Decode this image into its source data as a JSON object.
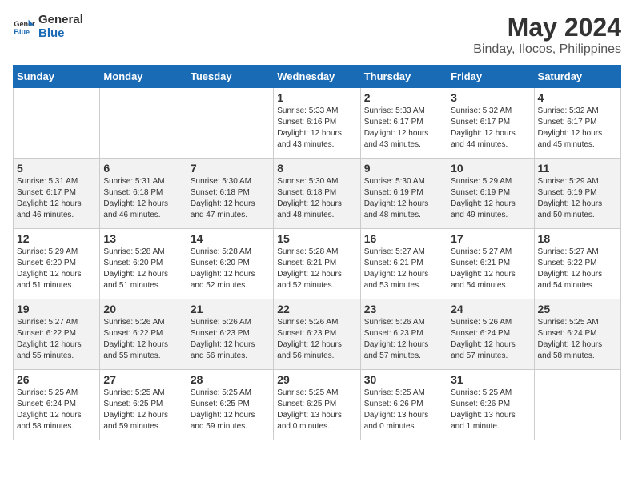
{
  "logo": {
    "line1": "General",
    "line2": "Blue"
  },
  "title": "May 2024",
  "subtitle": "Binday, Ilocos, Philippines",
  "days_of_week": [
    "Sunday",
    "Monday",
    "Tuesday",
    "Wednesday",
    "Thursday",
    "Friday",
    "Saturday"
  ],
  "weeks": [
    [
      {
        "day": "",
        "detail": ""
      },
      {
        "day": "",
        "detail": ""
      },
      {
        "day": "",
        "detail": ""
      },
      {
        "day": "1",
        "detail": "Sunrise: 5:33 AM\nSunset: 6:16 PM\nDaylight: 12 hours\nand 43 minutes."
      },
      {
        "day": "2",
        "detail": "Sunrise: 5:33 AM\nSunset: 6:17 PM\nDaylight: 12 hours\nand 43 minutes."
      },
      {
        "day": "3",
        "detail": "Sunrise: 5:32 AM\nSunset: 6:17 PM\nDaylight: 12 hours\nand 44 minutes."
      },
      {
        "day": "4",
        "detail": "Sunrise: 5:32 AM\nSunset: 6:17 PM\nDaylight: 12 hours\nand 45 minutes."
      }
    ],
    [
      {
        "day": "5",
        "detail": "Sunrise: 5:31 AM\nSunset: 6:17 PM\nDaylight: 12 hours\nand 46 minutes."
      },
      {
        "day": "6",
        "detail": "Sunrise: 5:31 AM\nSunset: 6:18 PM\nDaylight: 12 hours\nand 46 minutes."
      },
      {
        "day": "7",
        "detail": "Sunrise: 5:30 AM\nSunset: 6:18 PM\nDaylight: 12 hours\nand 47 minutes."
      },
      {
        "day": "8",
        "detail": "Sunrise: 5:30 AM\nSunset: 6:18 PM\nDaylight: 12 hours\nand 48 minutes."
      },
      {
        "day": "9",
        "detail": "Sunrise: 5:30 AM\nSunset: 6:19 PM\nDaylight: 12 hours\nand 48 minutes."
      },
      {
        "day": "10",
        "detail": "Sunrise: 5:29 AM\nSunset: 6:19 PM\nDaylight: 12 hours\nand 49 minutes."
      },
      {
        "day": "11",
        "detail": "Sunrise: 5:29 AM\nSunset: 6:19 PM\nDaylight: 12 hours\nand 50 minutes."
      }
    ],
    [
      {
        "day": "12",
        "detail": "Sunrise: 5:29 AM\nSunset: 6:20 PM\nDaylight: 12 hours\nand 51 minutes."
      },
      {
        "day": "13",
        "detail": "Sunrise: 5:28 AM\nSunset: 6:20 PM\nDaylight: 12 hours\nand 51 minutes."
      },
      {
        "day": "14",
        "detail": "Sunrise: 5:28 AM\nSunset: 6:20 PM\nDaylight: 12 hours\nand 52 minutes."
      },
      {
        "day": "15",
        "detail": "Sunrise: 5:28 AM\nSunset: 6:21 PM\nDaylight: 12 hours\nand 52 minutes."
      },
      {
        "day": "16",
        "detail": "Sunrise: 5:27 AM\nSunset: 6:21 PM\nDaylight: 12 hours\nand 53 minutes."
      },
      {
        "day": "17",
        "detail": "Sunrise: 5:27 AM\nSunset: 6:21 PM\nDaylight: 12 hours\nand 54 minutes."
      },
      {
        "day": "18",
        "detail": "Sunrise: 5:27 AM\nSunset: 6:22 PM\nDaylight: 12 hours\nand 54 minutes."
      }
    ],
    [
      {
        "day": "19",
        "detail": "Sunrise: 5:27 AM\nSunset: 6:22 PM\nDaylight: 12 hours\nand 55 minutes."
      },
      {
        "day": "20",
        "detail": "Sunrise: 5:26 AM\nSunset: 6:22 PM\nDaylight: 12 hours\nand 55 minutes."
      },
      {
        "day": "21",
        "detail": "Sunrise: 5:26 AM\nSunset: 6:23 PM\nDaylight: 12 hours\nand 56 minutes."
      },
      {
        "day": "22",
        "detail": "Sunrise: 5:26 AM\nSunset: 6:23 PM\nDaylight: 12 hours\nand 56 minutes."
      },
      {
        "day": "23",
        "detail": "Sunrise: 5:26 AM\nSunset: 6:23 PM\nDaylight: 12 hours\nand 57 minutes."
      },
      {
        "day": "24",
        "detail": "Sunrise: 5:26 AM\nSunset: 6:24 PM\nDaylight: 12 hours\nand 57 minutes."
      },
      {
        "day": "25",
        "detail": "Sunrise: 5:25 AM\nSunset: 6:24 PM\nDaylight: 12 hours\nand 58 minutes."
      }
    ],
    [
      {
        "day": "26",
        "detail": "Sunrise: 5:25 AM\nSunset: 6:24 PM\nDaylight: 12 hours\nand 58 minutes."
      },
      {
        "day": "27",
        "detail": "Sunrise: 5:25 AM\nSunset: 6:25 PM\nDaylight: 12 hours\nand 59 minutes."
      },
      {
        "day": "28",
        "detail": "Sunrise: 5:25 AM\nSunset: 6:25 PM\nDaylight: 12 hours\nand 59 minutes."
      },
      {
        "day": "29",
        "detail": "Sunrise: 5:25 AM\nSunset: 6:25 PM\nDaylight: 13 hours\nand 0 minutes."
      },
      {
        "day": "30",
        "detail": "Sunrise: 5:25 AM\nSunset: 6:26 PM\nDaylight: 13 hours\nand 0 minutes."
      },
      {
        "day": "31",
        "detail": "Sunrise: 5:25 AM\nSunset: 6:26 PM\nDaylight: 13 hours\nand 1 minute."
      },
      {
        "day": "",
        "detail": ""
      }
    ]
  ]
}
